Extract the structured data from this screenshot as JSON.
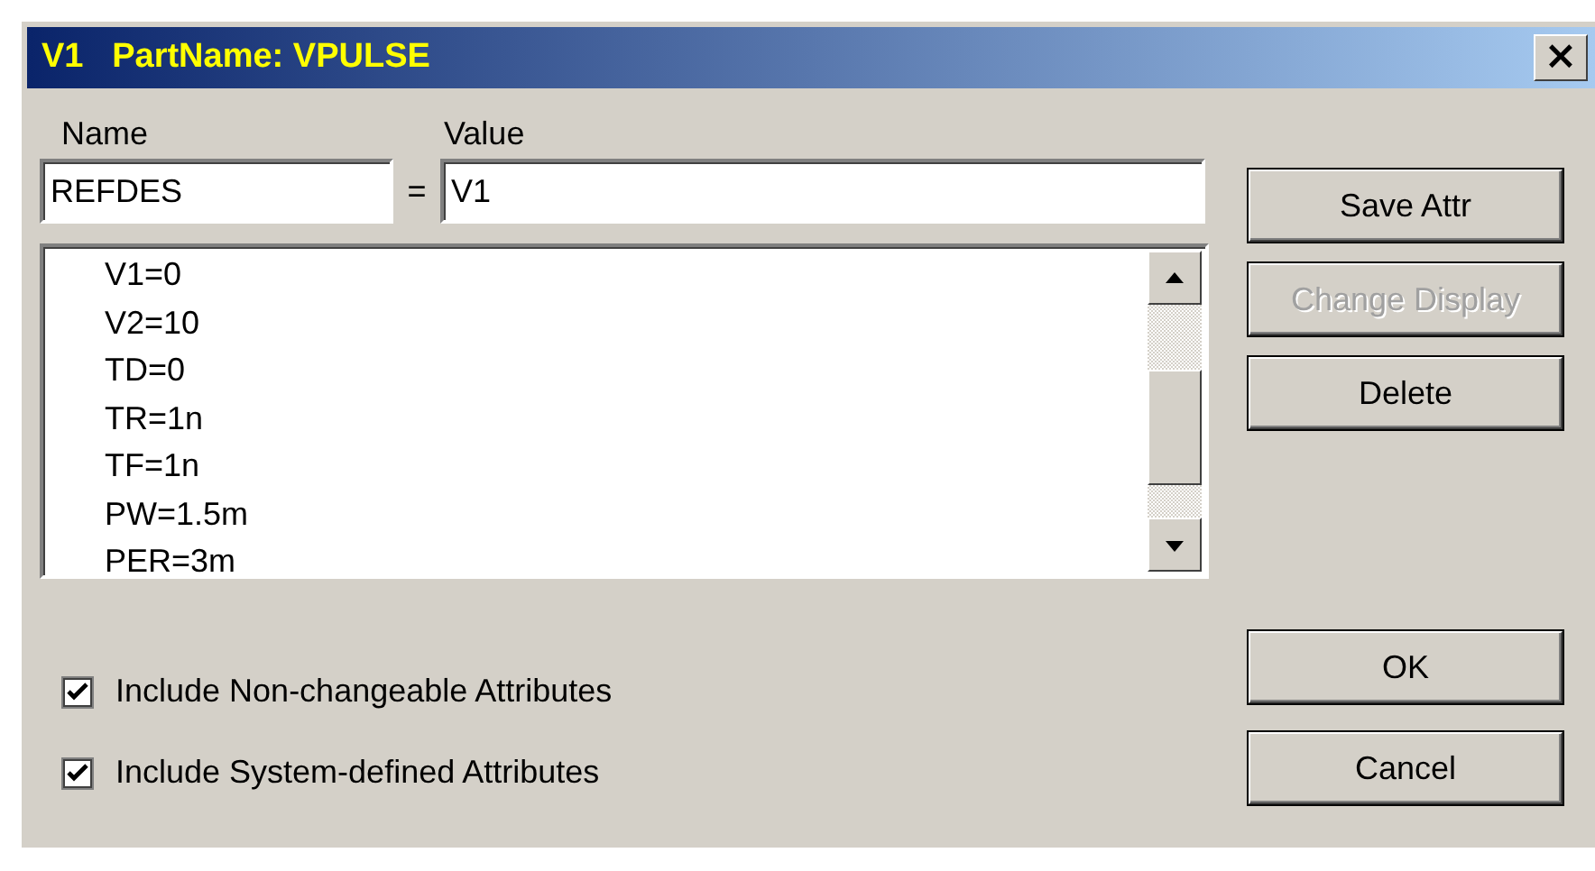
{
  "window": {
    "title": "V1   PartName: VPULSE",
    "close": "×"
  },
  "name_label": "Name",
  "value_label": "Value",
  "name_field": {
    "value": "REFDES"
  },
  "equals": "=",
  "value_field": {
    "value": "V1"
  },
  "attributes": [
    "V1=0",
    "V2=10",
    "TD=0",
    "TR=1n",
    "TF=1n",
    "PW=1.5m",
    "PER=3m"
  ],
  "side_buttons": [
    {
      "label": "Save Attr",
      "disabled": false
    },
    {
      "label": "Change Display",
      "disabled": true
    },
    {
      "label": "Delete",
      "disabled": false
    }
  ],
  "checkboxes": [
    {
      "label": "Include Non-changeable Attributes",
      "checked": true
    },
    {
      "label": "Include System-defined Attributes",
      "checked": true
    }
  ],
  "bottom_buttons": [
    {
      "label": "OK",
      "disabled": false
    },
    {
      "label": "Cancel",
      "disabled": false
    }
  ]
}
